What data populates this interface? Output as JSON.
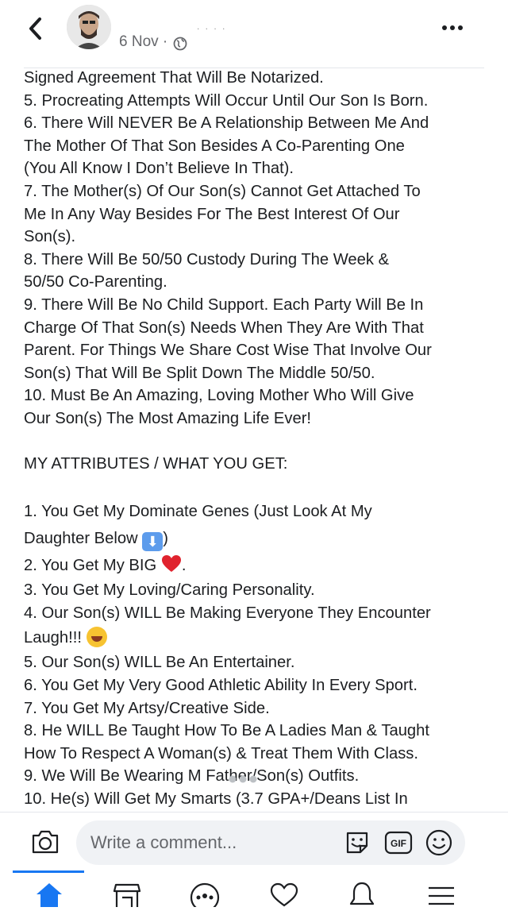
{
  "header": {
    "back_icon": "chevron-left-icon",
    "author_name": ". . . .",
    "date": "6 Nov ·",
    "privacy_icon": "globe-icon",
    "more_icon": "more-icon"
  },
  "post": {
    "lines": [
      "Signed Agreement That Will Be Notarized.",
      "5. Procreating Attempts Will Occur Until Our Son Is Born.",
      "6. There Will NEVER Be A Relationship Between Me And",
      "The Mother Of That Son Besides A Co-Parenting One",
      "(You All Know I Don’t Believe In That).",
      "7. The Mother(s) Of Our Son(s) Cannot Get Attached To",
      "Me In Any Way Besides For The Best Interest Of Our",
      "Son(s).",
      "8. There Will Be 50/50 Custody During The Week &",
      "50/50 Co-Parenting.",
      "9. There Will Be No Child Support. Each Party Will Be In",
      "Charge Of That Son(s) Needs When They Are With That",
      "Parent. For Things We Share Cost Wise That Involve Our",
      "Son(s) That Will Be Split Down The Middle 50/50.",
      "10. Must Be An Amazing, Loving Mother Who Will Give",
      "Our Son(s) The Most Amazing Life Ever!"
    ],
    "attributes_heading": "MY ATTRIBUTES / WHAT YOU GET:",
    "attr_1a": "1. You Get My Dominate Genes (Just Look At My",
    "attr_1b_pre": "Daughter Below ",
    "attr_1b_emoji": "⬇",
    "attr_1b_post": ")",
    "attr_2_pre": "2. You Get My BIG ",
    "attr_2_post": ".",
    "attr_3": "3. You Get My Loving/Caring Personality.",
    "attr_4a": "4. Our Son(s) WILL Be Making Everyone They Encounter",
    "attr_4b": "Laugh!!! ",
    "attr_5": "5. Our Son(s) WILL Be An Entertainer.",
    "attr_6": "6. You Get My Very Good Athletic Ability In Every Sport.",
    "attr_7": "7. You Get My Artsy/Creative Side.",
    "attr_8a": "8. He WILL Be Taught How To Be A Ladies Man & Taught",
    "attr_8b": "How To Respect A Woman(s) & Treat Them With Class.",
    "attr_9": "9. We Will Be Wearing M          Father/Son(s) Outfits.",
    "attr_10": "10. He(s) Will Get My Smarts (3.7 GPA+/Deans List In"
  },
  "comment_bar": {
    "camera_icon": "camera-icon",
    "placeholder": "Write a comment...",
    "sticker_icon": "sticker-icon",
    "gif_label": "GIF",
    "emoji_icon": "smiley-icon"
  },
  "tabbar": {
    "active_tab": "home",
    "tabs": [
      "home",
      "marketplace",
      "groups",
      "dating",
      "notifications",
      "menu"
    ],
    "accent_color": "#1877f2"
  }
}
